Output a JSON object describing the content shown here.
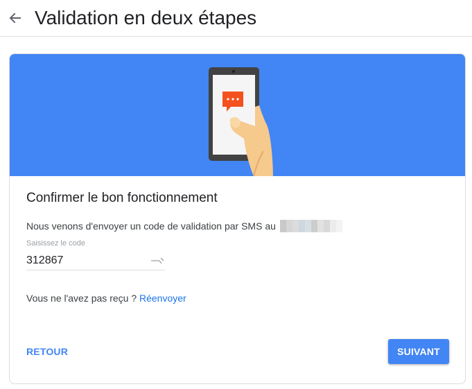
{
  "header": {
    "title": "Validation en deux étapes"
  },
  "icons": {
    "back": "arrow-back-icon",
    "illustration": "phone-sms-illustration",
    "key": "key-icon"
  },
  "card": {
    "title": "Confirmer le bon fonctionnement",
    "sms_text": "Nous venons d'envoyer un code de validation par SMS au",
    "code_field": {
      "label": "Saisissez le code",
      "value": "312867"
    },
    "resend_prompt": "Vous ne l'avez pas reçu ? ",
    "resend_link": "Réenvoyer",
    "back_button": "RETOUR",
    "next_button": "SUIVANT"
  },
  "colors": {
    "primary": "#4285f4",
    "link": "#1a73e8",
    "banner": "#4285f4",
    "chat_bubble": "#ff5722"
  }
}
